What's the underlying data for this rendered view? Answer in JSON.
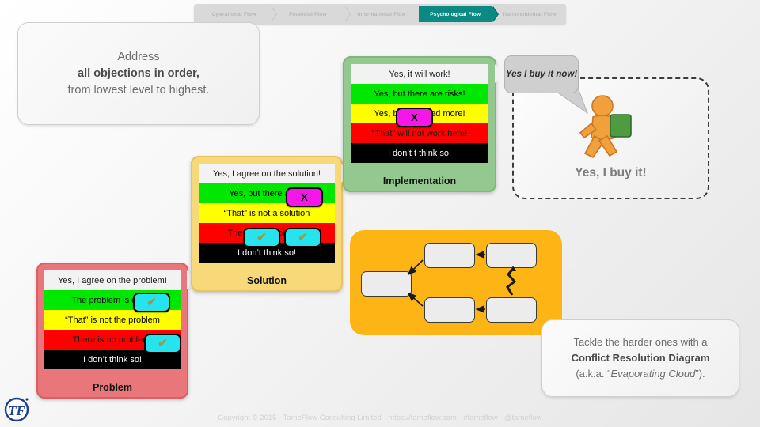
{
  "breadcrumb": {
    "items": [
      {
        "label": "Operational Flow",
        "active": false
      },
      {
        "label": "Financial Flow",
        "active": false
      },
      {
        "label": "Informational Flow",
        "active": false
      },
      {
        "label": "Psychological Flow",
        "active": true
      },
      {
        "label": "Transcendental Flow",
        "active": false
      }
    ],
    "active_color": "#0b8a84",
    "inactive_color": "#d9d9d9"
  },
  "intro_callout": {
    "line1": "Address",
    "line2": "all objections in order,",
    "line3": "from lowest level to highest."
  },
  "stacks": [
    {
      "id": "problem",
      "caption": "Problem",
      "frame_color": "#e8767a",
      "rows": [
        {
          "text": "Yes, I agree on the problem!",
          "color": "#f2f2f2"
        },
        {
          "text": "The problem is out of",
          "color": "#00e800"
        },
        {
          "text": "“That” is not the problem",
          "color": "#ffff00"
        },
        {
          "text": "There is no problem!",
          "color": "#ff0000"
        },
        {
          "text": "I don’t think so!",
          "color": "#000000"
        }
      ],
      "badges": [
        {
          "row": 1,
          "kind": "ok",
          "glyph": "✔",
          "color": "#25e4ee"
        },
        {
          "row": 3,
          "kind": "ok",
          "glyph": "✔",
          "color": "#25e4ee"
        }
      ]
    },
    {
      "id": "solution",
      "caption": "Solution",
      "frame_color": "#f7d97a",
      "rows": [
        {
          "text": "Yes, I agree on the solution!",
          "color": "#f2f2f2"
        },
        {
          "text": "Yes, but there are n",
          "color": "#00e800"
        },
        {
          "text": "“That” is not a solution",
          "color": "#ffff00"
        },
        {
          "text": "There is no solution!",
          "color": "#ff0000"
        },
        {
          "text": "I don’t think so!",
          "color": "#000000"
        }
      ],
      "badges": [
        {
          "row": 1,
          "kind": "no",
          "glyph": "X",
          "color": "#f517e8"
        },
        {
          "row": 3,
          "kind": "ok",
          "glyph": "✔",
          "color": "#25e4ee"
        },
        {
          "row": 3,
          "kind": "ok",
          "glyph": "✔",
          "color": "#25e4ee"
        }
      ]
    },
    {
      "id": "implementation",
      "caption": "Implementation",
      "frame_color": "#93c98f",
      "rows": [
        {
          "text": "Yes, it will work!",
          "color": "#f2f2f2"
        },
        {
          "text": "Yes, but there are risks!",
          "color": "#00e800"
        },
        {
          "text": "Yes, but we need more!",
          "color": "#ffff00"
        },
        {
          "text": "“That” will not work here!",
          "color": "#ff0000"
        },
        {
          "text": "I don’t t think so!",
          "color": "#000000"
        }
      ],
      "badges": [
        {
          "row": 2,
          "kind": "no",
          "glyph": "X",
          "color": "#f517e8"
        }
      ]
    }
  ],
  "customer": {
    "speech_bubble": "Yes I buy it now!",
    "label": "Yes, I buy it!",
    "figure_color": "#f2a03c",
    "bag_color": "#4f9b3f"
  },
  "crd_panel": {
    "fill_color": "#fdb515",
    "node_count": 5,
    "nodes": [
      "",
      "",
      "",
      "",
      ""
    ]
  },
  "crd_callout": {
    "line1": "Tackle the harder ones with a",
    "line2": "Conflict Resolution Diagram",
    "line3_prefix": "(a.k.a. “",
    "line3_italic": "Evaporating Cloud",
    "line3_suffix": "”)."
  },
  "footer": {
    "text": "Copyright © 2015 - TameFlow Consulting Limited - https://tameflow.com - #tameflow - @tameflow",
    "logo_text": "TF"
  }
}
